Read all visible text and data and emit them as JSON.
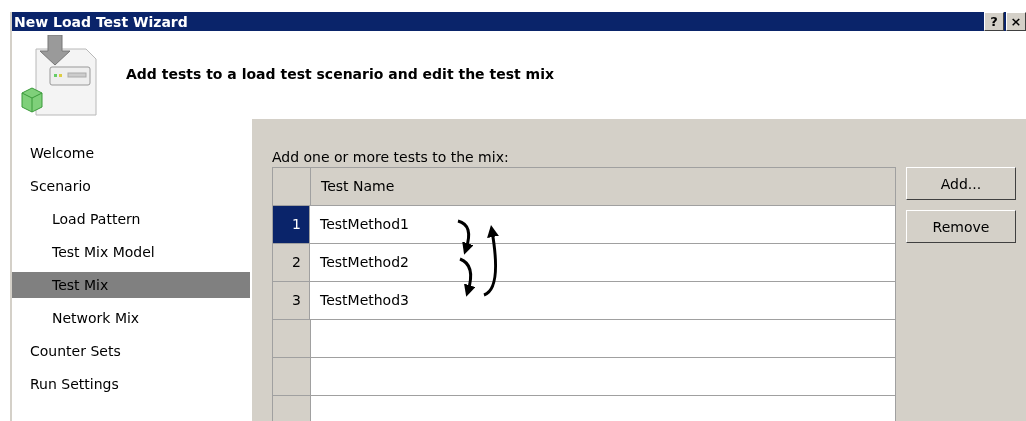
{
  "window": {
    "title": "New Load Test Wizard",
    "title_buttons": [
      "?",
      "×"
    ]
  },
  "header": {
    "text": "Add tests to a load test scenario and edit the test mix"
  },
  "sidebar": {
    "items": [
      {
        "label": "Welcome",
        "selected": false
      },
      {
        "label": "Scenario",
        "selected": false,
        "children": [
          {
            "label": "Load Pattern",
            "selected": false
          },
          {
            "label": "Test Mix Model",
            "selected": false
          },
          {
            "label": "Test Mix",
            "selected": true
          },
          {
            "label": "Network Mix",
            "selected": false
          }
        ]
      },
      {
        "label": "Counter Sets",
        "selected": false
      },
      {
        "label": "Run Settings",
        "selected": false
      }
    ]
  },
  "content": {
    "prompt": "Add one or more tests to the mix:",
    "table": {
      "columns": [
        "Test Name"
      ],
      "rows": [
        {
          "number": "1",
          "name": "TestMethod1",
          "selected": true
        },
        {
          "number": "2",
          "name": "TestMethod2",
          "selected": false
        },
        {
          "number": "3",
          "name": "TestMethod3",
          "selected": false
        }
      ]
    },
    "buttons": [
      "Add...",
      "Remove"
    ]
  }
}
